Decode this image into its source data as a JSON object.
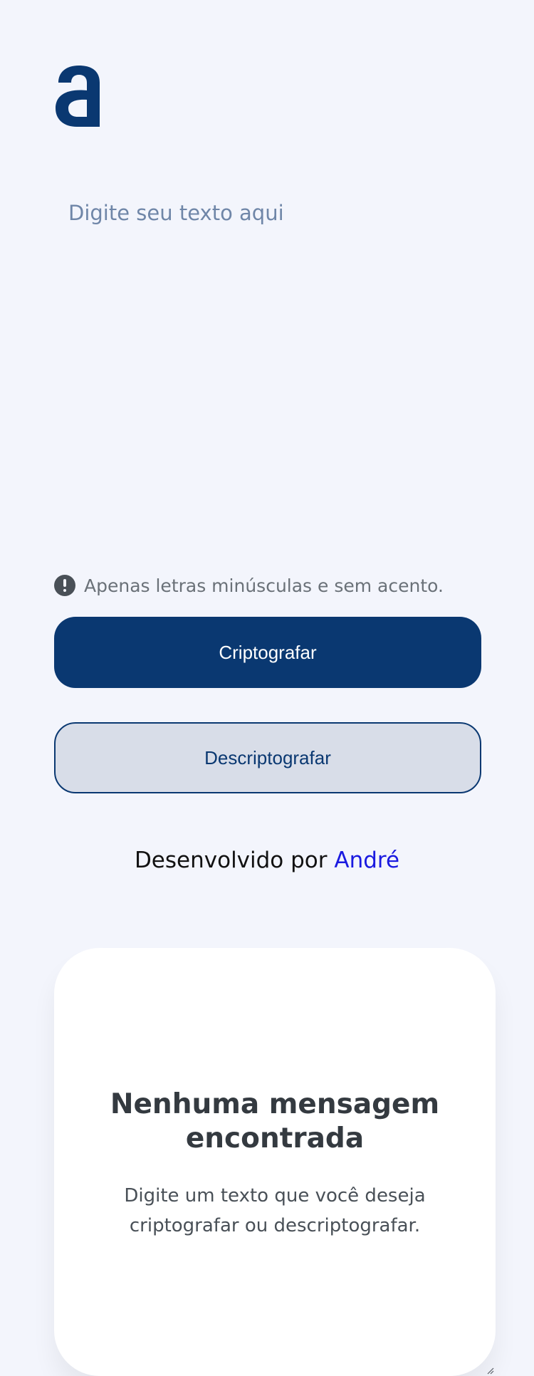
{
  "logo": {
    "icon": "letter-a-logo-icon",
    "color": "#0a3871"
  },
  "input": {
    "placeholder": "Digite seu texto aqui",
    "value": ""
  },
  "warning": {
    "icon": "exclamation-circle-icon",
    "text": "Apenas letras minúsculas e sem acento."
  },
  "buttons": {
    "encrypt_label": "Criptografar",
    "decrypt_label": "Descriptografar"
  },
  "footer": {
    "prefix": "Desenvolvido por ",
    "author": "André"
  },
  "output": {
    "title": "Nenhuma mensagem encontrada",
    "subtitle": "Digite um texto que você deseja criptografar ou descriptografar."
  },
  "colors": {
    "background": "#f3f5fc",
    "primary": "#0a3871",
    "secondary_button": "#d8dde8",
    "link": "#1a1ae0"
  }
}
